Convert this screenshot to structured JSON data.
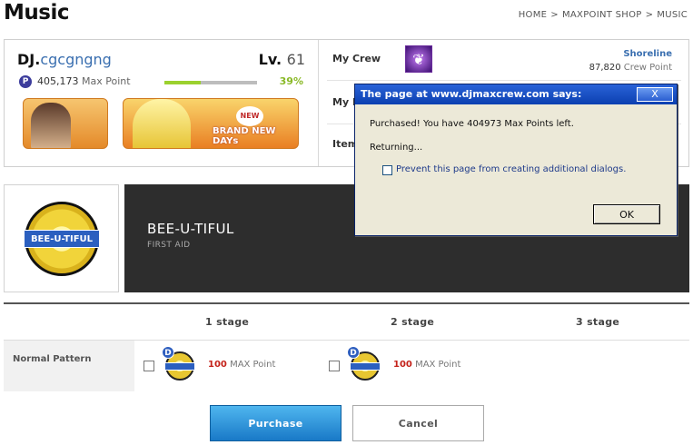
{
  "page": {
    "title": "Music",
    "breadcrumb": [
      "HOME",
      "MAXPOINT SHOP",
      "MUSIC"
    ],
    "breadcrumb_sep": ">"
  },
  "profile": {
    "dj_prefix": "DJ.",
    "dj_name": "cgcgngng",
    "level_label": "Lv.",
    "level": "61",
    "points_badge": "P",
    "max_points": "405,173",
    "max_points_unit": "Max Point",
    "xp_percent_label": "39%",
    "xp_fraction": 0.39,
    "banner_text": "BRAND NEW DAYs",
    "banner_new": "NEW"
  },
  "crew": {
    "my_crew_label": "My Crew",
    "crew_name": "Shoreline",
    "crew_points": "87,820",
    "crew_points_unit": "Crew Point",
    "my_id_label": "My ID",
    "items_label": "Items"
  },
  "song": {
    "title": "BEE-U-TIFUL",
    "artist": "FIRST AID",
    "disc_text": "BEE-U-TIFUL"
  },
  "stages": {
    "headers": [
      "1 stage",
      "2 stage",
      "3 stage"
    ],
    "row_label": "Normal Pattern",
    "options": [
      {
        "badge": "D",
        "price": "100",
        "unit": "MAX Point"
      },
      {
        "badge": "D",
        "price": "100",
        "unit": "MAX Point"
      }
    ]
  },
  "buttons": {
    "purchase": "Purchase",
    "cancel": "Cancel"
  },
  "dialog": {
    "title": "The page at www.djmaxcrew.com says:",
    "close": "X",
    "message": "Purchased!  You have 404973 Max Points left.",
    "returning": "Returning...",
    "checkbox_label": "Prevent this page from creating additional dialogs.",
    "ok": "OK"
  },
  "colors": {
    "accent_blue": "#3a6fb0",
    "price_red": "#c4221a",
    "xp_green": "#8ab928",
    "dialog_titlebar": "#0b3fb0"
  }
}
